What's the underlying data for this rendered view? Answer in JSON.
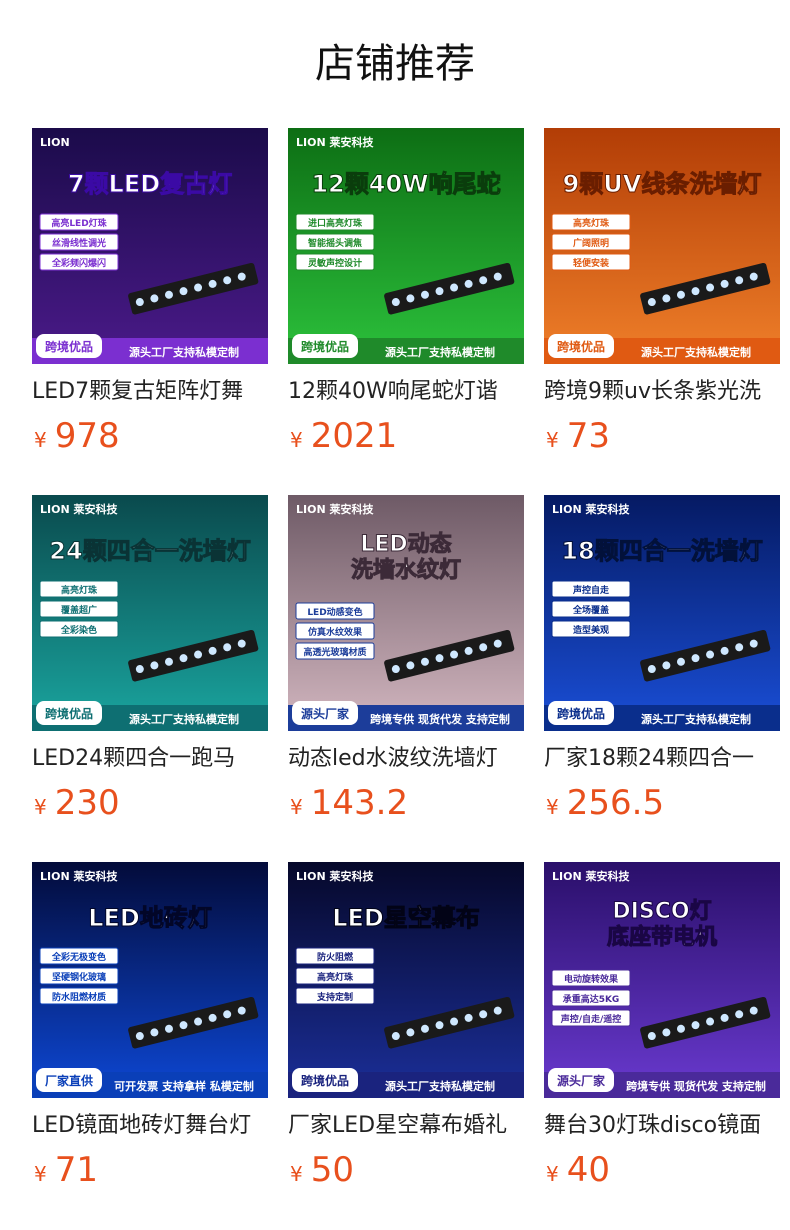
{
  "header": {
    "title": "店铺推荐"
  },
  "currency": "¥",
  "products": [
    {
      "name": "LED7颗复古矩阵灯舞",
      "price": "978",
      "thumb": {
        "headline": "7颗LED复古灯",
        "tags": [
          "高亮LED灯珠",
          "丝滑线性调光",
          "全彩频闪爆闪"
        ],
        "brand": "LION",
        "badge": "跨境优品",
        "footer": "源头工厂支持私模定制",
        "accent": "#7b2fd0"
      }
    },
    {
      "name": "12颗40W响尾蛇灯谐",
      "price": "2021",
      "thumb": {
        "headline": "12颗40W响尾蛇",
        "tags": [
          "进口高亮灯珠",
          "智能摇头调焦",
          "灵敏声控设计"
        ],
        "brand": "LION 莱安科技",
        "badge": "跨境优品",
        "footer": "源头工厂支持私模定制",
        "accent": "#1f8a2a"
      }
    },
    {
      "name": "跨境9颗uv长条紫光洗",
      "price": "73",
      "thumb": {
        "headline": "9颗UV线条洗墙灯",
        "tags": [
          "高亮灯珠",
          "广阔照明",
          "轻便安装"
        ],
        "brand": "",
        "badge": "跨境优品",
        "footer": "源头工厂支持私模定制",
        "accent": "#e05a12"
      }
    },
    {
      "name": "LED24颗四合一跑马",
      "price": "230",
      "thumb": {
        "headline": "24颗四合一洗墙灯",
        "tags": [
          "高亮灯珠",
          "覆盖超广",
          "全彩染色"
        ],
        "brand": "LION 莱安科技",
        "badge": "跨境优品",
        "footer": "源头工厂支持私模定制",
        "accent": "#0e6f72"
      }
    },
    {
      "name": "动态led水波纹洗墙灯",
      "price": "143.2",
      "thumb": {
        "headline": "LED动态洗墙水纹灯",
        "tags": [
          "LED动感变色",
          "仿真水纹效果",
          "高透光玻璃材质"
        ],
        "brand": "LION 莱安科技",
        "badge": "源头厂家",
        "footer": "跨境专供 现货代发 支持定制",
        "accent": "#1c3d9a"
      }
    },
    {
      "name": "厂家18颗24颗四合一",
      "price": "256.5",
      "thumb": {
        "headline": "18颗四合一洗墙灯",
        "tags": [
          "声控自走",
          "全场覆盖",
          "造型美观"
        ],
        "brand": "LION 莱安科技",
        "badge": "跨境优品",
        "footer": "源头工厂支持私模定制",
        "accent": "#0a2e8c"
      }
    },
    {
      "name": "LED镜面地砖灯舞台灯",
      "price": "71",
      "thumb": {
        "headline": "LED地砖灯",
        "tags": [
          "全彩无极变色",
          "坚硬钢化玻璃",
          "防水阻燃材质"
        ],
        "brand": "LION 莱安科技",
        "badge": "厂家直供",
        "footer": "可开发票 支持拿样 私模定制",
        "accent": "#0a3fb8"
      }
    },
    {
      "name": "厂家LED星空幕布婚礼",
      "price": "50",
      "thumb": {
        "headline": "LED星空幕布",
        "tags": [
          "防火阻燃",
          "高亮灯珠",
          "支持定制"
        ],
        "brand": "LION 莱安科技",
        "badge": "跨境优品",
        "footer": "源头工厂支持私模定制",
        "accent": "#1a237e"
      }
    },
    {
      "name": "舞台30灯珠disco镜面",
      "price": "40",
      "thumb": {
        "headline": "DISCO灯底座带电机",
        "tags": [
          "电动旋转效果",
          "承重高达5KG",
          "声控/自走/遥控"
        ],
        "brand": "LION 莱安科技",
        "badge": "源头厂家",
        "footer": "跨境专供 现货代发 支持定制",
        "accent": "#4a2a9a"
      }
    }
  ]
}
